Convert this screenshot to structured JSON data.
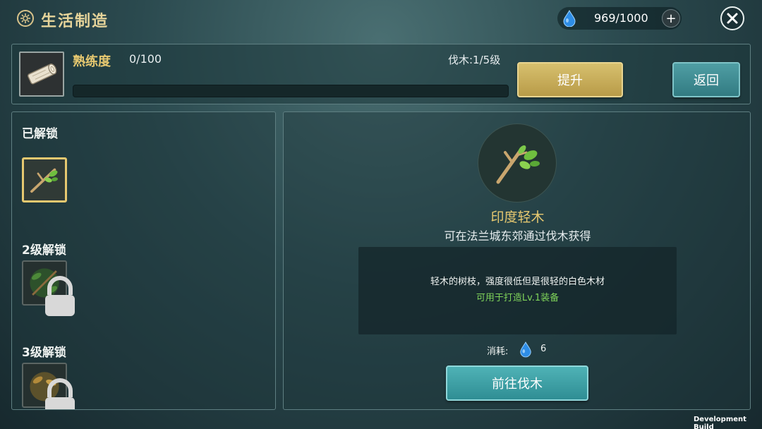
{
  "header": {
    "title": "生活制造",
    "energy": "969/1000",
    "energy_plus": "+"
  },
  "proficiency": {
    "label": "熟练度",
    "value": "0/100",
    "progress": 0,
    "skill_level": "伐木:1/5级",
    "upgrade_label": "提升",
    "back_label": "返回"
  },
  "left_panel": {
    "unlocked_label": "已解锁",
    "level2_label": "2级解锁",
    "level3_label": "3级解锁"
  },
  "detail": {
    "name": "印度轻木",
    "source": "可在法兰城东郊通过伐木获得",
    "description": "轻木的树枝，强度很低但是很轻的白色木材",
    "usage": "可用于打造Lv.1装备",
    "cost_label": "消耗:",
    "cost_value": "6",
    "goto_label": "前往伐木"
  },
  "footer": {
    "build_label": "Development Build"
  },
  "colors": {
    "gold": "#e6c870",
    "green_text": "#7fd35a",
    "teal_button": "#3f9ea4"
  }
}
